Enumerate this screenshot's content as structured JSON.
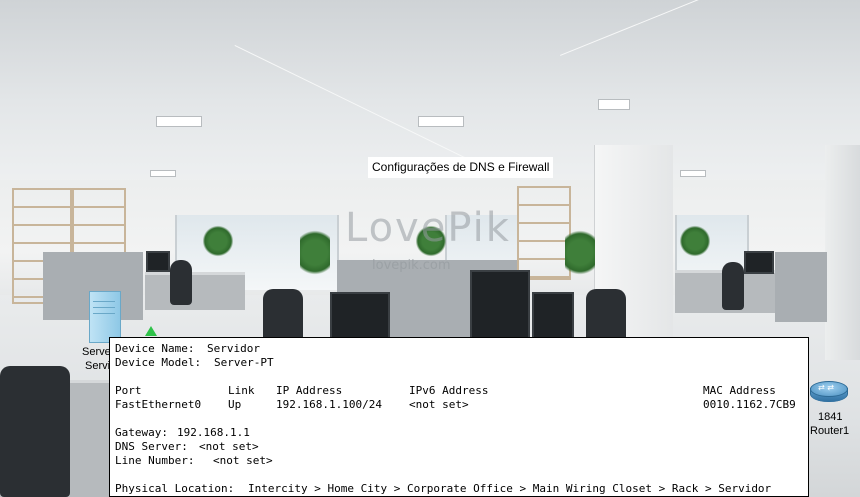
{
  "canvas_label": "Configurações de DNS e Firewall",
  "watermark": {
    "main": "LovePik",
    "sub": "lovepik.com"
  },
  "server": {
    "label_line1": "Serve",
    "label_line2": "Servi"
  },
  "router": {
    "model": "1841",
    "name": "Router1"
  },
  "tooltip": {
    "device_name_label": "Device Name:",
    "device_name": "Servidor",
    "device_model_label": "Device Model:",
    "device_model": "Server-PT",
    "headers": {
      "port": "Port",
      "link": "Link",
      "ip": "IP Address",
      "ipv6": "IPv6 Address",
      "mac": "MAC Address"
    },
    "interfaces": [
      {
        "port": "FastEthernet0",
        "link": "Up",
        "ip": "192.168.1.100/24",
        "ipv6": "<not set>",
        "mac": "0010.1162.7CB9"
      }
    ],
    "gateway_label": "Gateway:",
    "gateway": "192.168.1.1",
    "dns_label": "DNS Server:",
    "dns": "<not set>",
    "line_number_label": "Line Number:",
    "line_number": "<not set>",
    "location_label": "Physical Location:",
    "location": "Intercity > Home City > Corporate Office > Main Wiring Closet > Rack > Servidor"
  },
  "colors": {
    "link_up": "#2fc24a",
    "tooltip_bg": "#ffffff"
  },
  "icons": {
    "server": "server-icon",
    "router": "router-icon",
    "link": "link-up-triangle-icon"
  }
}
